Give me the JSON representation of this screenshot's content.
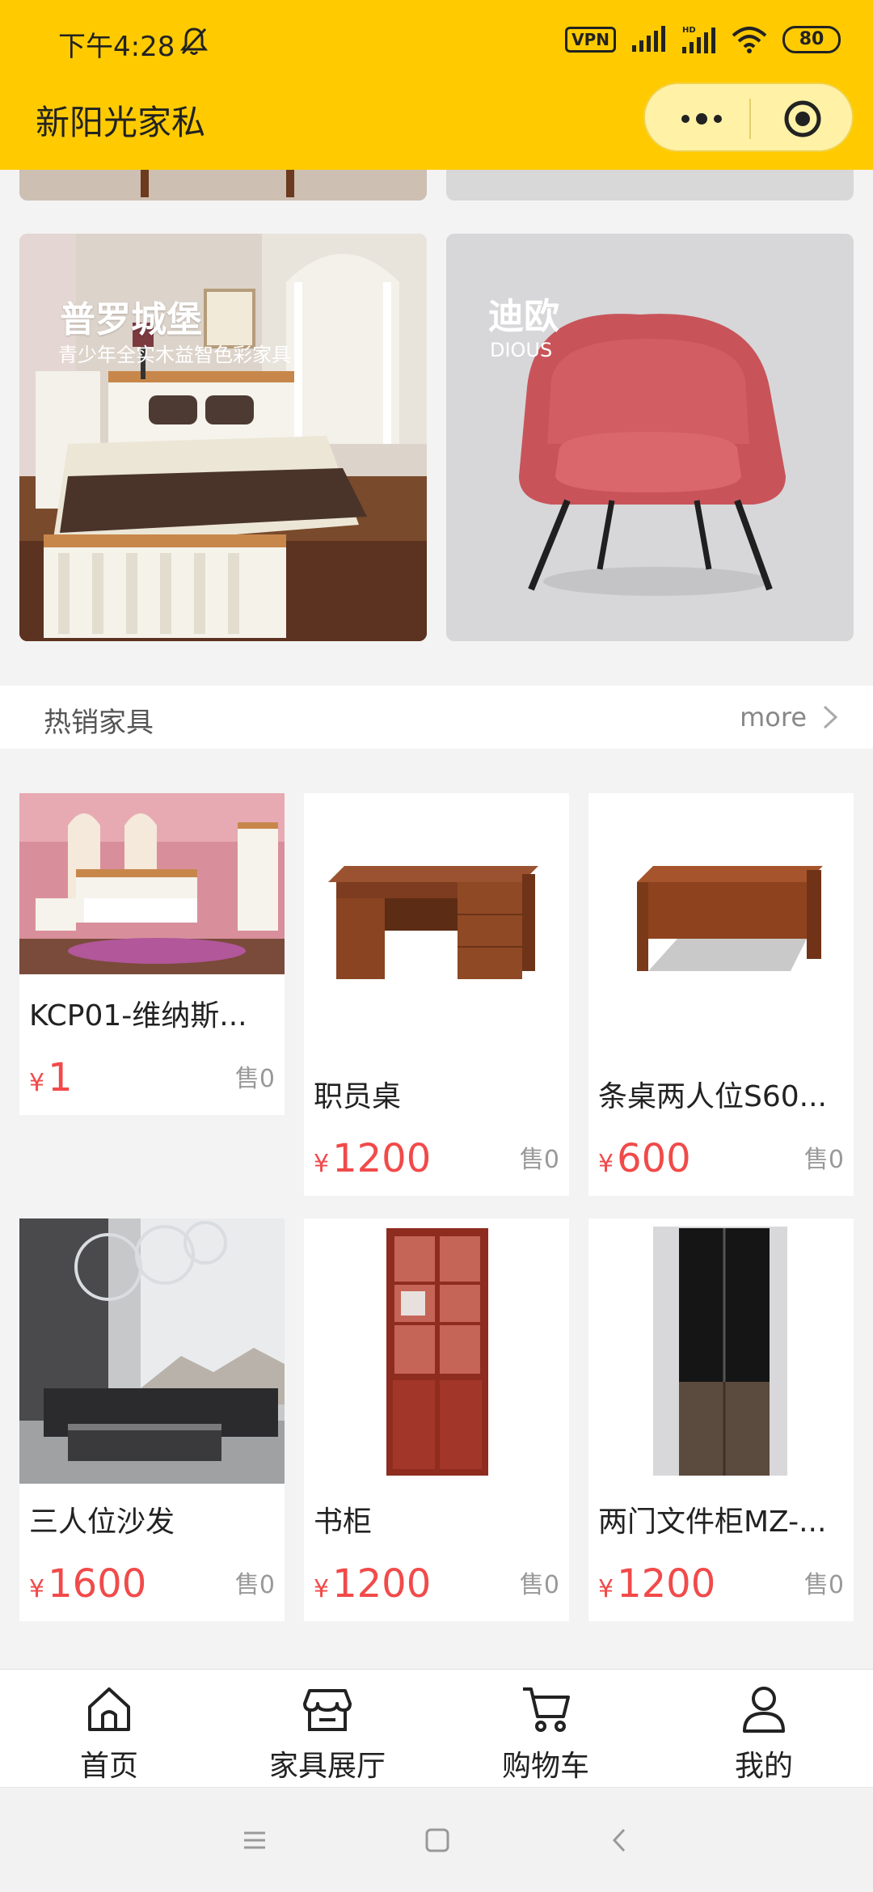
{
  "status_bar": {
    "time": "下午4:28",
    "vpn": "VPN",
    "battery": "80"
  },
  "header": {
    "title": "新阳光家私"
  },
  "banners": [
    {
      "title": "普罗城堡",
      "subtitle": "青少年全实木益智色彩家具"
    },
    {
      "title": "迪欧",
      "subtitle": "DIOUS"
    }
  ],
  "section": {
    "title": "热销家具",
    "more": "more"
  },
  "currency": "¥",
  "sold_prefix": "售",
  "products": [
    {
      "name": "KCP01-维纳斯...",
      "price": "1",
      "sold": "售0"
    },
    {
      "name": "职员桌",
      "price": "1200",
      "sold": "售0"
    },
    {
      "name": "条桌两人位S60...",
      "price": "600",
      "sold": "售0"
    },
    {
      "name": "三人位沙发",
      "price": "1600",
      "sold": "售0"
    },
    {
      "name": "书柜",
      "price": "1200",
      "sold": "售0"
    },
    {
      "name": "两门文件柜MZ-...",
      "price": "1200",
      "sold": "售0"
    }
  ],
  "tabs": [
    {
      "label": "首页",
      "icon": "home-icon"
    },
    {
      "label": "家具展厅",
      "icon": "store-icon"
    },
    {
      "label": "购物车",
      "icon": "cart-icon"
    },
    {
      "label": "我的",
      "icon": "user-icon"
    }
  ],
  "colors": {
    "accent": "#ffcb00",
    "price": "#f14a4a"
  }
}
